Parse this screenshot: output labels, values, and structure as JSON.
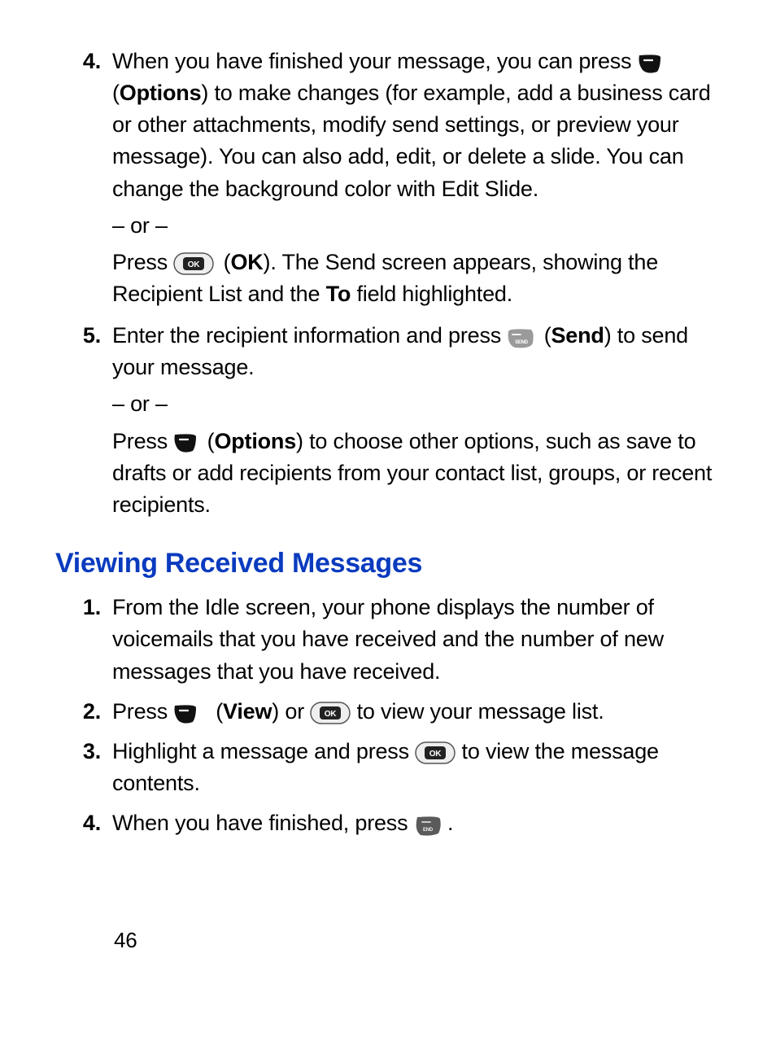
{
  "page_number": "46",
  "block1": {
    "items": [
      {
        "num": "4.",
        "p1a": "When you have finished your message, you can press ",
        "p1b_bold": "Options",
        "p1c": ") to make changes (for example, add a business card or other attachments, modify send settings, or preview your message). You can also add, edit, or delete a slide. You can change the background color with Edit Slide.",
        "or": "– or –",
        "p2a": "Press ",
        "p2b_bold": "OK",
        "p2c": "). The Send screen appears, showing the Recipient List and the ",
        "p2d_bold": "To",
        "p2e": " field highlighted."
      },
      {
        "num": "5.",
        "p1a": "Enter the recipient information and press ",
        "p1b_bold": "Send",
        "p1c": ") to send your message.",
        "or": "– or –",
        "p2a": "Press ",
        "p2b_bold": "Options",
        "p2c": ") to choose other options, such as save to drafts or add recipients from your contact list, groups, or recent recipients."
      }
    ]
  },
  "heading": "Viewing Received Messages",
  "block2": {
    "items": [
      {
        "num": "1.",
        "p1": "From the Idle screen, your phone displays the number of voicemails that you have received and the number of new messages that you have received."
      },
      {
        "num": "2.",
        "p1a": "Press ",
        "p1b_bold": "View",
        "p1c": ") or ",
        "p1d": " to view your message list."
      },
      {
        "num": "3.",
        "p1a": "Highlight a message and press ",
        "p1b": " to view the message contents."
      },
      {
        "num": "4.",
        "p1a": "When you have finished, press ",
        "p1b": "."
      }
    ]
  }
}
